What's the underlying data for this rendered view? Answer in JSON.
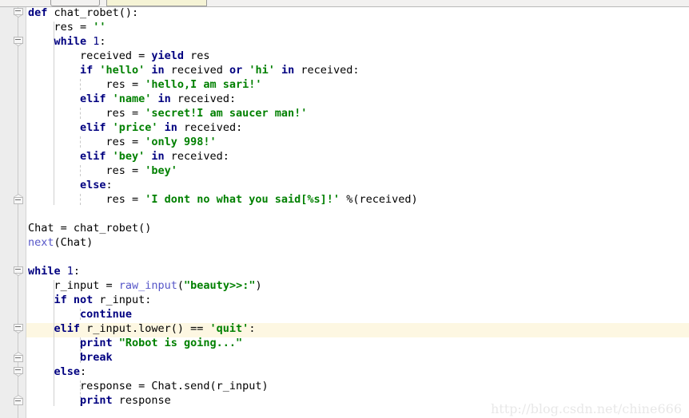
{
  "window": {
    "toolbar_button_label": "",
    "active_tab_label": "",
    "watermark": "http://blog.csdn.net/chine666"
  },
  "editor": {
    "language": "Python",
    "current_line_index": 22,
    "colors": {
      "background": "#ffffff",
      "gutter": "#ededed",
      "keyword": "#000080",
      "string": "#008000",
      "builtin": "#5656c8",
      "text": "#000000",
      "current_line_highlight": "#fdf7e2",
      "watermark": "#e8e8e8"
    },
    "fold_markers": [
      {
        "line": 0,
        "state": "expanded"
      },
      {
        "line": 2,
        "state": "expanded"
      },
      {
        "line": 13,
        "state": "collapsed-end"
      },
      {
        "line": 18,
        "state": "expanded"
      },
      {
        "line": 22,
        "state": "expanded"
      },
      {
        "line": 24,
        "state": "collapsed-end"
      },
      {
        "line": 25,
        "state": "expanded"
      },
      {
        "line": 27,
        "state": "collapsed-end"
      }
    ],
    "lines": [
      {
        "indent": 0,
        "text": "def chat_robet():"
      },
      {
        "indent": 1,
        "text": "res = ''"
      },
      {
        "indent": 1,
        "text": "while 1:"
      },
      {
        "indent": 2,
        "text": "received = yield res"
      },
      {
        "indent": 2,
        "text": "if 'hello' in received or 'hi' in received:"
      },
      {
        "indent": 3,
        "text": "res = 'hello,I am sari!'"
      },
      {
        "indent": 2,
        "text": "elif 'name' in received:"
      },
      {
        "indent": 3,
        "text": "res = 'secret!I am saucer man!'"
      },
      {
        "indent": 2,
        "text": "elif 'price' in received:"
      },
      {
        "indent": 3,
        "text": "res = 'only 998!'"
      },
      {
        "indent": 2,
        "text": "elif 'bey' in received:"
      },
      {
        "indent": 3,
        "text": "res = 'bey'"
      },
      {
        "indent": 2,
        "text": "else:"
      },
      {
        "indent": 3,
        "text": "res = 'I dont no what you said[%s]!' %(received)"
      },
      {
        "indent": 0,
        "text": ""
      },
      {
        "indent": 0,
        "text": "Chat = chat_robet()"
      },
      {
        "indent": 0,
        "text": "next(Chat)"
      },
      {
        "indent": 0,
        "text": ""
      },
      {
        "indent": 0,
        "text": "while 1:"
      },
      {
        "indent": 1,
        "text": "r_input = raw_input(\"beauty>>:\")"
      },
      {
        "indent": 1,
        "text": "if not r_input:"
      },
      {
        "indent": 2,
        "text": "continue"
      },
      {
        "indent": 1,
        "text": "elif r_input.lower() == 'quit':"
      },
      {
        "indent": 2,
        "text": "print \"Robot is going...\""
      },
      {
        "indent": 2,
        "text": "break"
      },
      {
        "indent": 1,
        "text": "else:"
      },
      {
        "indent": 2,
        "text": "response = Chat.send(r_input)"
      },
      {
        "indent": 2,
        "text": "print response"
      }
    ],
    "tokens": [
      [
        [
          "kw",
          "def"
        ],
        [
          "nm",
          " chat_robet():"
        ]
      ],
      [
        [
          "nm",
          "res = "
        ],
        [
          "st",
          "''"
        ]
      ],
      [
        [
          "kw",
          "while"
        ],
        [
          "nm",
          " "
        ],
        [
          "num",
          "1"
        ],
        [
          "nm",
          ":"
        ]
      ],
      [
        [
          "nm",
          "received = "
        ],
        [
          "kw",
          "yield"
        ],
        [
          "nm",
          " res"
        ]
      ],
      [
        [
          "kw",
          "if"
        ],
        [
          "nm",
          " "
        ],
        [
          "st",
          "'hello'"
        ],
        [
          "nm",
          " "
        ],
        [
          "kw",
          "in"
        ],
        [
          "nm",
          " received "
        ],
        [
          "kw",
          "or"
        ],
        [
          "nm",
          " "
        ],
        [
          "st",
          "'hi'"
        ],
        [
          "nm",
          " "
        ],
        [
          "kw",
          "in"
        ],
        [
          "nm",
          " received:"
        ]
      ],
      [
        [
          "nm",
          "res = "
        ],
        [
          "st",
          "'hello,I am sari!'"
        ]
      ],
      [
        [
          "kw",
          "elif"
        ],
        [
          "nm",
          " "
        ],
        [
          "st",
          "'name'"
        ],
        [
          "nm",
          " "
        ],
        [
          "kw",
          "in"
        ],
        [
          "nm",
          " received:"
        ]
      ],
      [
        [
          "nm",
          "res = "
        ],
        [
          "st",
          "'secret!I am saucer man!'"
        ]
      ],
      [
        [
          "kw",
          "elif"
        ],
        [
          "nm",
          " "
        ],
        [
          "st",
          "'price'"
        ],
        [
          "nm",
          " "
        ],
        [
          "kw",
          "in"
        ],
        [
          "nm",
          " received:"
        ]
      ],
      [
        [
          "nm",
          "res = "
        ],
        [
          "st",
          "'only 998!'"
        ]
      ],
      [
        [
          "kw",
          "elif"
        ],
        [
          "nm",
          " "
        ],
        [
          "st",
          "'bey'"
        ],
        [
          "nm",
          " "
        ],
        [
          "kw",
          "in"
        ],
        [
          "nm",
          " received:"
        ]
      ],
      [
        [
          "nm",
          "res = "
        ],
        [
          "st",
          "'bey'"
        ]
      ],
      [
        [
          "kw",
          "else"
        ],
        [
          "nm",
          ":"
        ]
      ],
      [
        [
          "nm",
          "res = "
        ],
        [
          "st",
          "'I dont no what you said[%s]!'"
        ],
        [
          "nm",
          " %(received)"
        ]
      ],
      [],
      [
        [
          "nm",
          "Chat = chat_robet()"
        ]
      ],
      [
        [
          "bi",
          "next"
        ],
        [
          "nm",
          "(Chat)"
        ]
      ],
      [],
      [
        [
          "kw",
          "while"
        ],
        [
          "nm",
          " "
        ],
        [
          "num",
          "1"
        ],
        [
          "nm",
          ":"
        ]
      ],
      [
        [
          "nm",
          "r_input = "
        ],
        [
          "bi",
          "raw_input"
        ],
        [
          "nm",
          "("
        ],
        [
          "st",
          "\"beauty>>:\""
        ],
        [
          "nm",
          ")"
        ]
      ],
      [
        [
          "kw",
          "if"
        ],
        [
          "nm",
          " "
        ],
        [
          "kw",
          "not"
        ],
        [
          "nm",
          " r_input:"
        ]
      ],
      [
        [
          "kw",
          "continue"
        ]
      ],
      [
        [
          "kw",
          "elif"
        ],
        [
          "nm",
          " r_input.lower() == "
        ],
        [
          "st",
          "'quit'"
        ],
        [
          "nm",
          ":"
        ]
      ],
      [
        [
          "kw",
          "print"
        ],
        [
          "nm",
          " "
        ],
        [
          "st",
          "\"Robot is going...\""
        ]
      ],
      [
        [
          "kw",
          "break"
        ]
      ],
      [
        [
          "kw",
          "else"
        ],
        [
          "nm",
          ":"
        ]
      ],
      [
        [
          "nm",
          "response = Chat.send(r_input)"
        ]
      ],
      [
        [
          "kw",
          "print"
        ],
        [
          "nm",
          " response"
        ]
      ]
    ]
  }
}
